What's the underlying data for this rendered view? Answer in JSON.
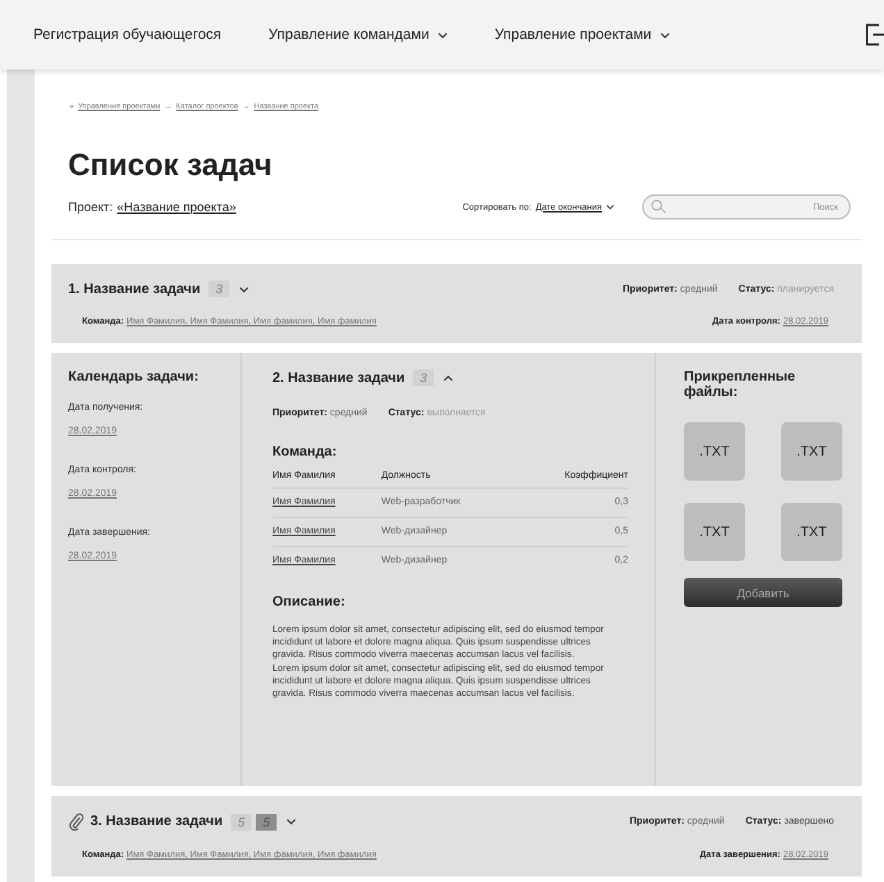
{
  "nav": {
    "items": [
      {
        "label": "Регистрация обучающегося",
        "dropdown": false
      },
      {
        "label": "Управление командами",
        "dropdown": true
      },
      {
        "label": "Управление проектами",
        "dropdown": true
      }
    ]
  },
  "breadcrumb": [
    {
      "sep": "»",
      "label": "Управление проектами"
    },
    {
      "sep": "→",
      "label": "Каталог проектов"
    },
    {
      "sep": "→",
      "label": "Название проекта"
    }
  ],
  "title": "Список задач",
  "project": {
    "label": "Проект:",
    "value": "«Название проекта»"
  },
  "sort": {
    "label": "Сортировать по:",
    "value": "Дате окончания"
  },
  "search": {
    "placeholder": "Поиск"
  },
  "tasks": [
    {
      "title": "1. Название задачи",
      "attachment": false,
      "expanded": false,
      "counts": [
        {
          "value": "3",
          "kind": "light"
        }
      ],
      "priority_label": "Приоритет:",
      "priority": "средний",
      "status_label": "Статус:",
      "status": "планируется",
      "status_done": false,
      "team_label": "Команда:",
      "team": "Имя Фамилия, Имя Фамилия, Имя фамилия, Имя фамилия",
      "date_label": "Дата контроля:",
      "date": "28.02.2019"
    },
    {
      "title": "2. Название задачи",
      "attachment": false,
      "expanded": true,
      "counts": [
        {
          "value": "3",
          "kind": "light"
        }
      ],
      "priority_label": "Приоритет:",
      "priority": "средний",
      "status_label": "Статус:",
      "status": "выполняется",
      "status_done": false,
      "calendar": {
        "title": "Календарь задачи:",
        "dates": [
          {
            "label": "Дата получения:",
            "value": "28.02.2019"
          },
          {
            "label": "Дата контроля:",
            "value": "28.02.2019"
          },
          {
            "label": "Дата завершения:",
            "value": "28.02.2019"
          }
        ]
      },
      "team_title": "Команда:",
      "team_columns": [
        "Имя Фамилия",
        "Должность",
        "Коэффициент"
      ],
      "team_rows": [
        {
          "name": "Имя Фамилия",
          "role": "Web-разработчик",
          "coef": "0,3"
        },
        {
          "name": "Имя Фамилия",
          "role": "Web-дизайнер",
          "coef": "0,5"
        },
        {
          "name": "Имя Фамилия",
          "role": "Web-дизайнер",
          "coef": "0,2"
        }
      ],
      "description_title": "Описание:",
      "description": [
        "Lorem ipsum dolor sit amet, consectetur adipiscing elit, sed do eiusmod tempor incididunt ut labore et dolore magna aliqua. Quis ipsum suspendisse ultrices gravida. Risus commodo viverra maecenas accumsan lacus vel facilisis.",
        "Lorem ipsum dolor sit amet, consectetur adipiscing elit, sed do eiusmod tempor incididunt ut labore et dolore magna aliqua. Quis ipsum suspendisse ultrices gravida. Risus commodo viverra maecenas accumsan lacus vel facilisis."
      ],
      "files_title": "Прикрепленные файлы:",
      "files": [
        ".TXT",
        ".TXT",
        ".TXT",
        ".TXT"
      ],
      "add_button": "Добавить"
    },
    {
      "title": "3. Название задачи",
      "attachment": true,
      "expanded": false,
      "counts": [
        {
          "value": "5",
          "kind": "light"
        },
        {
          "value": "5",
          "kind": "dark"
        }
      ],
      "priority_label": "Приоритет:",
      "priority": "средний",
      "status_label": "Статус:",
      "status": "завершено",
      "status_done": true,
      "team_label": "Команда:",
      "team": "Имя Фамилия, Имя Фамилия, Имя фамилия, Имя фамилия",
      "date_label": "Дата завершения:",
      "date": "28.02.2019"
    }
  ]
}
